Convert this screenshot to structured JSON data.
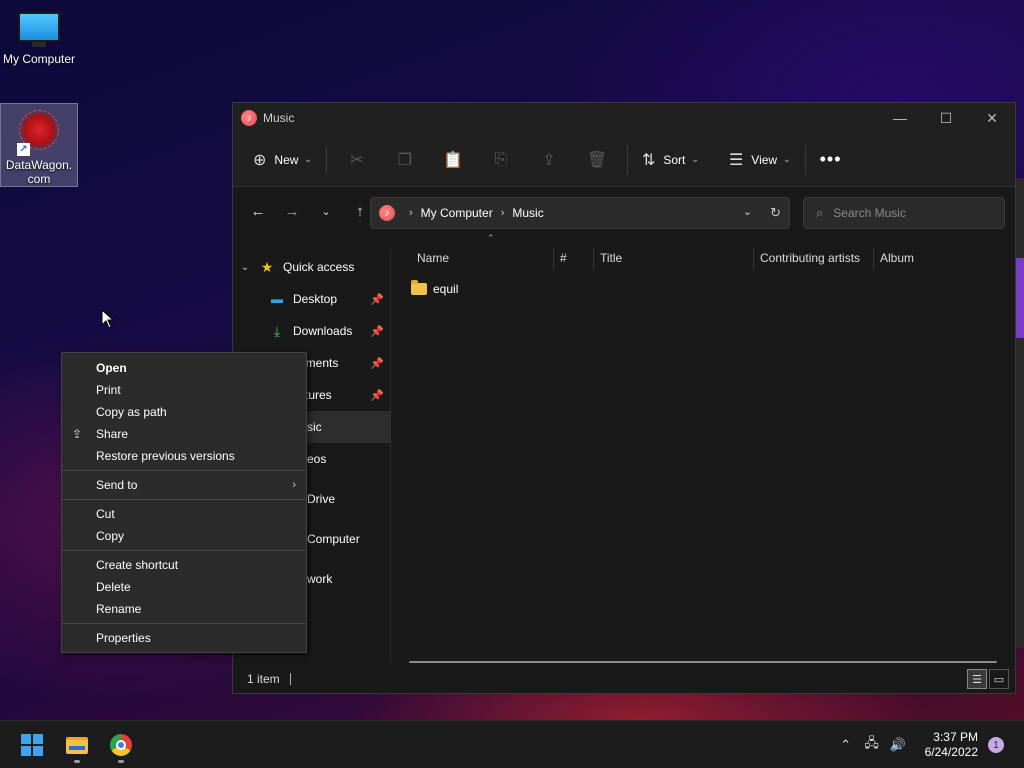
{
  "desktop": {
    "icons": [
      {
        "label": "My Computer"
      },
      {
        "label": "DataWagon.com"
      }
    ]
  },
  "window": {
    "title": "Music",
    "toolbar": {
      "new_label": "New",
      "sort_label": "Sort",
      "view_label": "View"
    },
    "address": {
      "crumbs": [
        "My Computer",
        "Music"
      ]
    },
    "search": {
      "placeholder": "Search Music"
    },
    "nav": {
      "items": [
        {
          "label": "Quick access"
        },
        {
          "label": "Desktop"
        },
        {
          "label": "Downloads"
        },
        {
          "label": "Documents",
          "visible": "cuments"
        },
        {
          "label": "Pictures",
          "visible": "tures"
        },
        {
          "label": "Music",
          "visible": "sic"
        },
        {
          "label": "Videos",
          "visible": "eos"
        },
        {
          "label": "OneDrive",
          "visible": "Drive"
        },
        {
          "label": "My Computer",
          "visible": "Computer"
        },
        {
          "label": "Network",
          "visible": "work"
        }
      ]
    },
    "columns": [
      "Name",
      "#",
      "Title",
      "Contributing artists",
      "Album"
    ],
    "files": [
      {
        "name": "equil",
        "type": "folder"
      }
    ],
    "status": {
      "count": "1 item"
    }
  },
  "context_menu": {
    "groups": [
      [
        "Open",
        "Print",
        "Copy as path",
        "Share",
        "Restore previous versions"
      ],
      [
        "Send to"
      ],
      [
        "Cut",
        "Copy"
      ],
      [
        "Create shortcut",
        "Delete",
        "Rename"
      ],
      [
        "Properties"
      ]
    ]
  },
  "taskbar": {
    "time": "3:37 PM",
    "date": "6/24/2022",
    "notification_count": "1"
  },
  "colors": {
    "accent": "#3da4f0",
    "folder": "#f2c147",
    "window_bg": "#191919",
    "menu_bg": "#2b2b2b"
  }
}
